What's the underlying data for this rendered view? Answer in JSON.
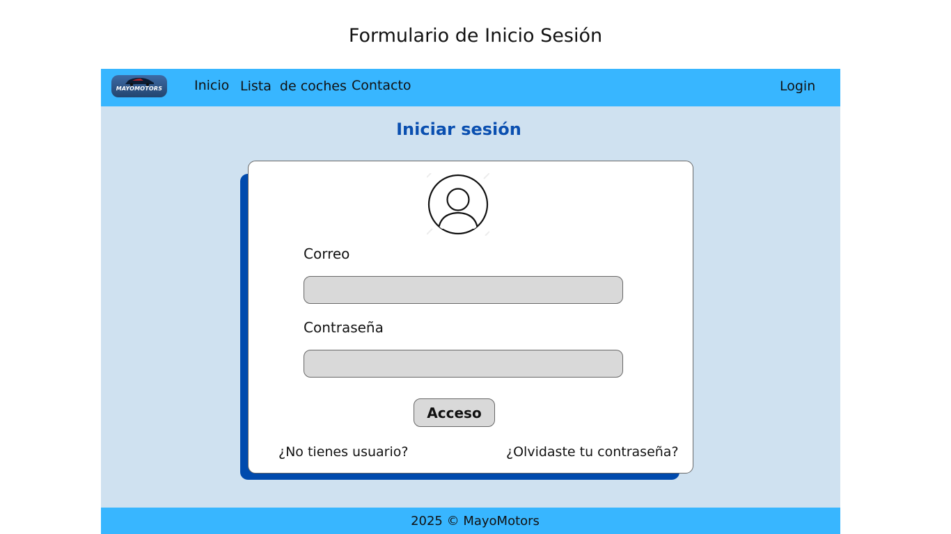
{
  "page": {
    "heading": "Formulario de Inicio Sesión"
  },
  "navbar": {
    "logo_text": "MAYOMOTORS",
    "links": [
      "Inicio",
      "Lista  de coches",
      "Contacto"
    ],
    "login_label": "Login"
  },
  "main": {
    "title": "Iniciar sesión",
    "avatar_icon": "user-circle-icon",
    "email_label": "Correo",
    "email_value": "",
    "password_label": "Contraseña",
    "password_value": "",
    "submit_label": "Acceso",
    "register_link": "¿No tienes usuario?",
    "forgot_link": "¿Olvidaste tu contraseña?"
  },
  "footer": {
    "text": "2025 © MayoMotors"
  },
  "colors": {
    "navbar": "#38b6ff",
    "background": "#cfe1f0",
    "accent": "#004aad",
    "title": "#0a4fb0",
    "input": "#d9d9d9"
  }
}
